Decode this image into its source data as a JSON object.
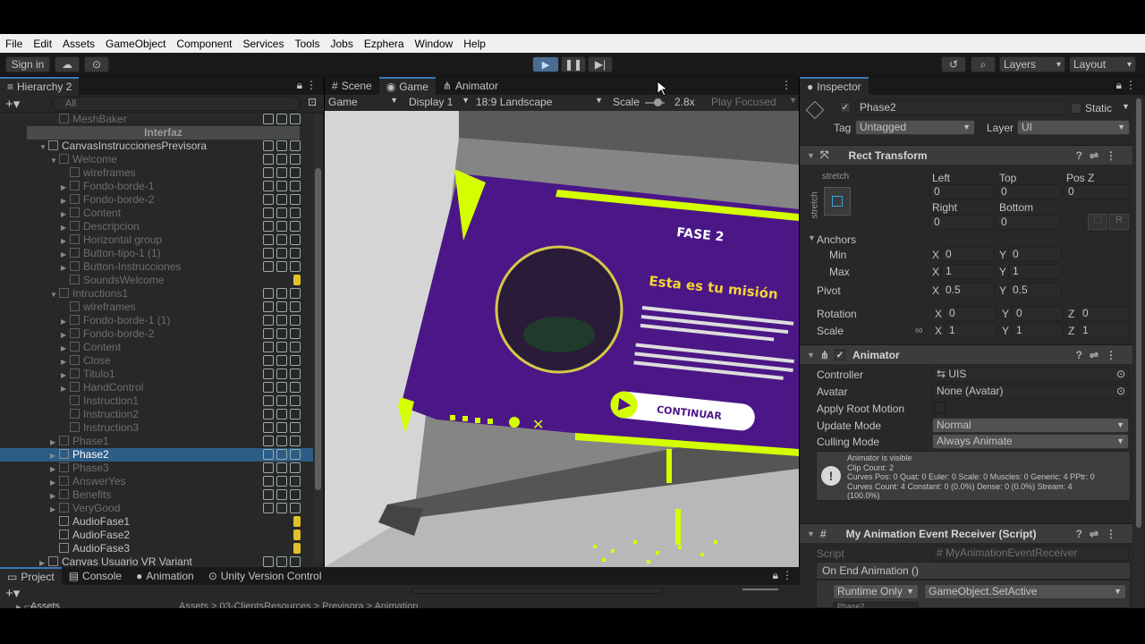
{
  "menu": [
    "File",
    "Edit",
    "Assets",
    "GameObject",
    "Component",
    "Services",
    "Tools",
    "Jobs",
    "Ezphera",
    "Window",
    "Help"
  ],
  "toolbar": {
    "signin": "Sign in",
    "layers": "Layers",
    "layout": "Layout"
  },
  "hierarchy": {
    "tab": "Hierarchy 2",
    "search_placeholder": "All",
    "rows": [
      {
        "label": "MeshBaker",
        "indent": 3,
        "dim": true
      },
      {
        "label": "Interfaz",
        "indent": 0,
        "header": true
      },
      {
        "label": "CanvasInstruccionesPrevisora",
        "indent": 2,
        "tri": "▼"
      },
      {
        "label": "Welcome",
        "indent": 3,
        "tri": "▼",
        "dim": true
      },
      {
        "label": "wireframes",
        "indent": 4,
        "dim": true
      },
      {
        "label": "Fondo-borde-1",
        "indent": 4,
        "tri": "▶",
        "dim": true
      },
      {
        "label": "Fondo-borde-2",
        "indent": 4,
        "tri": "▶",
        "dim": true
      },
      {
        "label": "Content",
        "indent": 4,
        "tri": "▶",
        "dim": true
      },
      {
        "label": "Descripcion",
        "indent": 4,
        "tri": "▶",
        "dim": true
      },
      {
        "label": "Horizontal group",
        "indent": 4,
        "tri": "▶",
        "dim": true
      },
      {
        "label": "Button-tipo-1 (1)",
        "indent": 4,
        "tri": "▶",
        "dim": true
      },
      {
        "label": "Button-Instrucciones",
        "indent": 4,
        "tri": "▶",
        "dim": true
      },
      {
        "label": "SoundsWelcome",
        "indent": 4,
        "dim": true
      },
      {
        "label": "Intructions1",
        "indent": 3,
        "tri": "▼",
        "dim": true
      },
      {
        "label": "wireframes",
        "indent": 4,
        "dim": true
      },
      {
        "label": "Fondo-borde-1 (1)",
        "indent": 4,
        "tri": "▶",
        "dim": true
      },
      {
        "label": "Fondo-borde-2",
        "indent": 4,
        "tri": "▶",
        "dim": true
      },
      {
        "label": "Content",
        "indent": 4,
        "tri": "▶",
        "dim": true
      },
      {
        "label": "Close",
        "indent": 4,
        "tri": "▶",
        "dim": true
      },
      {
        "label": "Titulo1",
        "indent": 4,
        "tri": "▶",
        "dim": true
      },
      {
        "label": "HandControl",
        "indent": 4,
        "tri": "▶",
        "dim": true
      },
      {
        "label": "Instruction1",
        "indent": 4,
        "dim": true
      },
      {
        "label": "Instruction2",
        "indent": 4,
        "dim": true
      },
      {
        "label": "Instruction3",
        "indent": 4,
        "dim": true
      },
      {
        "label": "Phase1",
        "indent": 3,
        "tri": "▶",
        "dim": true
      },
      {
        "label": "Phase2",
        "indent": 3,
        "tri": "▶",
        "sel": true
      },
      {
        "label": "Phase3",
        "indent": 3,
        "tri": "▶",
        "dim": true
      },
      {
        "label": "AnswerYes",
        "indent": 3,
        "tri": "▶",
        "dim": true
      },
      {
        "label": "Benefits",
        "indent": 3,
        "tri": "▶",
        "dim": true
      },
      {
        "label": "VeryGood",
        "indent": 3,
        "tri": "▶",
        "dim": true
      },
      {
        "label": "AudioFase1",
        "indent": 3
      },
      {
        "label": "AudioFase2",
        "indent": 3
      },
      {
        "label": "AudioFase3",
        "indent": 3
      },
      {
        "label": "Canvas Usuario VR Variant",
        "indent": 2,
        "tri": "▶"
      }
    ]
  },
  "sceneTabs": {
    "scene": "Scene",
    "game": "Game",
    "animator": "Animator"
  },
  "gameBar": {
    "game": "Game",
    "display": "Display 1",
    "aspect": "18:9 Landscape",
    "scale_label": "Scale",
    "scale_value": "2.8x",
    "play": "Play Focused"
  },
  "gameContent": {
    "fase": "FASE 2",
    "mision": "Esta es tu misión",
    "continuar": "CONTINUAR"
  },
  "inspector": {
    "tab": "Inspector",
    "name": "Phase2",
    "static": "Static",
    "tag_label": "Tag",
    "tag_value": "Untagged",
    "layer_label": "Layer",
    "layer_value": "UI",
    "rect": {
      "title": "Rect Transform",
      "stretch": "stretch",
      "left": "Left",
      "top": "Top",
      "posz": "Pos Z",
      "right": "Right",
      "bottom": "Bottom",
      "left_v": "0",
      "top_v": "0",
      "posz_v": "0",
      "right_v": "0",
      "bottom_v": "0",
      "anchors": "Anchors",
      "min": "Min",
      "max": "Max",
      "pivot": "Pivot",
      "rotation": "Rotation",
      "scale": "Scale",
      "min_x": "0",
      "min_y": "0",
      "max_x": "1",
      "max_y": "1",
      "pivot_x": "0.5",
      "pivot_y": "0.5",
      "rot_x": "0",
      "rot_y": "0",
      "rot_z": "0",
      "sc_x": "1",
      "sc_y": "1",
      "sc_z": "1",
      "r_btn": "R"
    },
    "animator": {
      "title": "Animator",
      "controller": "Controller",
      "controller_v": "UIS",
      "avatar": "Avatar",
      "avatar_v": "None (Avatar)",
      "root": "Apply Root Motion",
      "update": "Update Mode",
      "update_v": "Normal",
      "culling": "Culling Mode",
      "culling_v": "Always Animate",
      "help": [
        "Animator is visible",
        "Clip Count: 2",
        "Curves Pos: 0 Quat: 0 Euler: 0 Scale: 0 Muscles: 0 Generic: 4 PPtr: 0",
        "Curves Count: 4 Constant: 0 (0.0%) Dense: 0 (0.0%) Stream: 4",
        "(100.0%)"
      ]
    },
    "receiver": {
      "title": "My Animation Event Receiver (Script)",
      "script": "Script",
      "script_v": "MyAnimationEventReceiver",
      "event": "On End Animation ()",
      "runtime": "Runtime Only",
      "method": "GameObject.SetActive",
      "obj": "Phase2"
    }
  },
  "bottomTabs": {
    "project": "Project",
    "console": "Console",
    "animation": "Animation",
    "vcs": "Unity Version Control",
    "assets": "Assets",
    "path": "Assets > 03-ClientsResources > Previsora > Animation"
  }
}
